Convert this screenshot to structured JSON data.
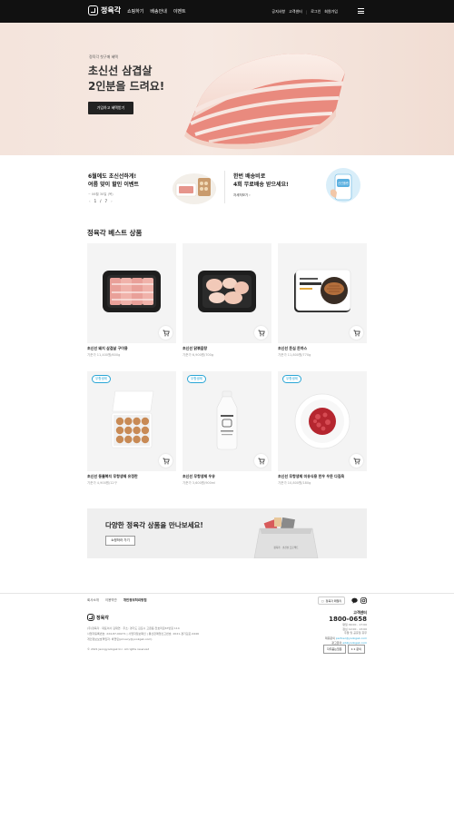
{
  "header": {
    "logo": "정육각",
    "nav": [
      "쇼핑하기",
      "배송안내",
      "이벤트"
    ],
    "util": [
      "공지사항",
      "고객센터",
      "로그인",
      "회원가입"
    ]
  },
  "hero": {
    "sub": "정육각 첫구매 혜택",
    "title_line1": "초신선 삼겹살",
    "title_line2": "2인분을 드려요!",
    "button": "가입하고 혜택받기"
  },
  "promo": {
    "left_line1": "6월에도 초신선하게!",
    "left_line2": "여름 맞이 할인 이벤트",
    "left_date": "~ 06월 30일 (목)",
    "page_current": "1",
    "page_total": "7",
    "right_line1": "한번 배송비로",
    "right_line2": "4회 무료배송 받으세요!",
    "right_link": "자세히보기",
    "right_badge": "신선플랜"
  },
  "best": {
    "title": "정육각 베스트 상품",
    "products": [
      {
        "name": "초신선 돼지 삼겹살 구이용",
        "price": "기준가 11,400원/600g",
        "badge": ""
      },
      {
        "name": "초신선 닭볶음탕",
        "price": "기준가 6,900원/700g",
        "badge": ""
      },
      {
        "name": "초신선 돈심 돈까스",
        "price": "기준가 11,800원/770g",
        "badge": ""
      },
      {
        "name": "초신선 동물복지 무항생제 유정란",
        "price": "기준가 4,900원/12구",
        "badge": "무항생제"
      },
      {
        "name": "초신선 무항생제 우유",
        "price": "기준가 3,600원/900ml",
        "badge": "무항생제"
      },
      {
        "name": "초신선 무항생제 미유식용 한우 우둔 다짐육",
        "price": "기준가 10,800원/180g",
        "badge": "무항생제"
      }
    ]
  },
  "banner": {
    "title": "다양한 정육각 상품을 만나보세요!",
    "button": "쇼핑하러 가기",
    "bag_text": "정육각 · 초신선 프로젝트"
  },
  "footer": {
    "links": [
      "회사소개",
      "이용약관",
      "개인정보처리방침"
    ],
    "family": "정육각 패밀리",
    "logo": "정육각",
    "info1": "(주)정육각 · 대표이사 김재연 · 주소: 경기도 김포시 고촌읍 전호리로67번길 114",
    "info2": "사업자등록번호: 224-87-00271 | 사업자정보확인 | 통신판매업신고번호: 2021-경기김포-0446",
    "info3": "개인정보보호책임자: 박현민(privacy@yookgak.com)",
    "copyright": "© 2021 Jeongyookgak Inc. All rights reserved",
    "cs_label": "고객센터",
    "cs_tel": "1800-0658",
    "cs_hours1": "평일 09:00 - 17:00",
    "cs_hours2": "점심 12:00 - 13:00",
    "cs_hours3": "주말 및 공휴일 휴무",
    "cs_partner_label": "제휴문의",
    "cs_partner_mail": "partner@yookgak.com",
    "cs_ad_label": "광고문의",
    "cs_ad_mail": "ad@yookgak.com",
    "cs_btn1": "자주묻는질문",
    "cs_btn2": "1:1 문의"
  }
}
